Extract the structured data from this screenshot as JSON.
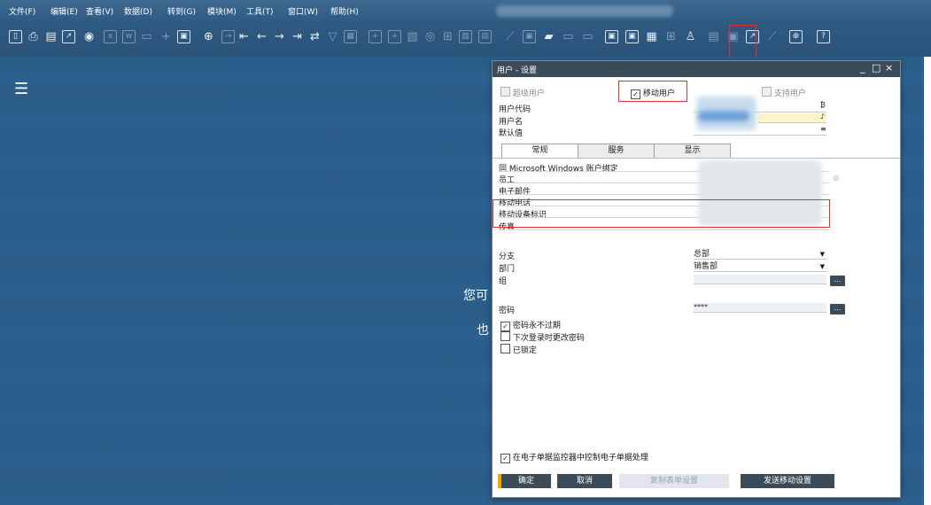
{
  "menubar": {
    "items": [
      "文件(F)",
      "编辑(E)",
      "查看(V)",
      "数据(D)",
      "转到(G)",
      "模块(M)",
      "工具(T)",
      "窗口(W)",
      "帮助(H)"
    ]
  },
  "desktop": {
    "menu_icon": "☰",
    "bg_text_1": "您可",
    "bg_text_2": "也"
  },
  "dialog": {
    "title": "用户 - 设置",
    "window_controls": [
      "_",
      "□",
      "×"
    ],
    "superuser_label": "超级用户",
    "mobile_user_label": "移动用户",
    "mobile_user_checked": true,
    "support_user_label": "支持用户",
    "user_code_label": "用户代码",
    "user_name_label": "用户名",
    "defaults_label": "默认值",
    "tabs": [
      "常规",
      "服务",
      "显示"
    ],
    "general": {
      "bind_windows_label": "同 Microsoft Windows 账户绑定",
      "employee_label": "员工",
      "email_label": "电子邮件",
      "mobile_phone_label": "移动电话",
      "mobile_device_id_label": "移动设备标识",
      "fax_label": "传真",
      "branch_label": "分支",
      "branch_value": "总部",
      "department_label": "部门",
      "department_value": "销售部",
      "group_label": "组",
      "password_label": "密码",
      "password_value": "****",
      "pw_never_expires_label": "密码永不过期",
      "pw_never_expires_checked": true,
      "change_pw_next_login_label": "下次登录时更改密码",
      "locked_label": "已锁定",
      "einvoice_label": "在电子单据监控器中控制电子单据处理",
      "einvoice_checked": true
    },
    "buttons": {
      "ok": "确定",
      "cancel": "取消",
      "copy_form": "复制表单设置",
      "send_mobile": "发送移动设置"
    },
    "ellipsis": "…"
  },
  "colors": {
    "titlebar": "#3c4b58",
    "desktop": "#2a5b87",
    "highlight": "#e03030",
    "ok_accent": "#f0a800"
  }
}
